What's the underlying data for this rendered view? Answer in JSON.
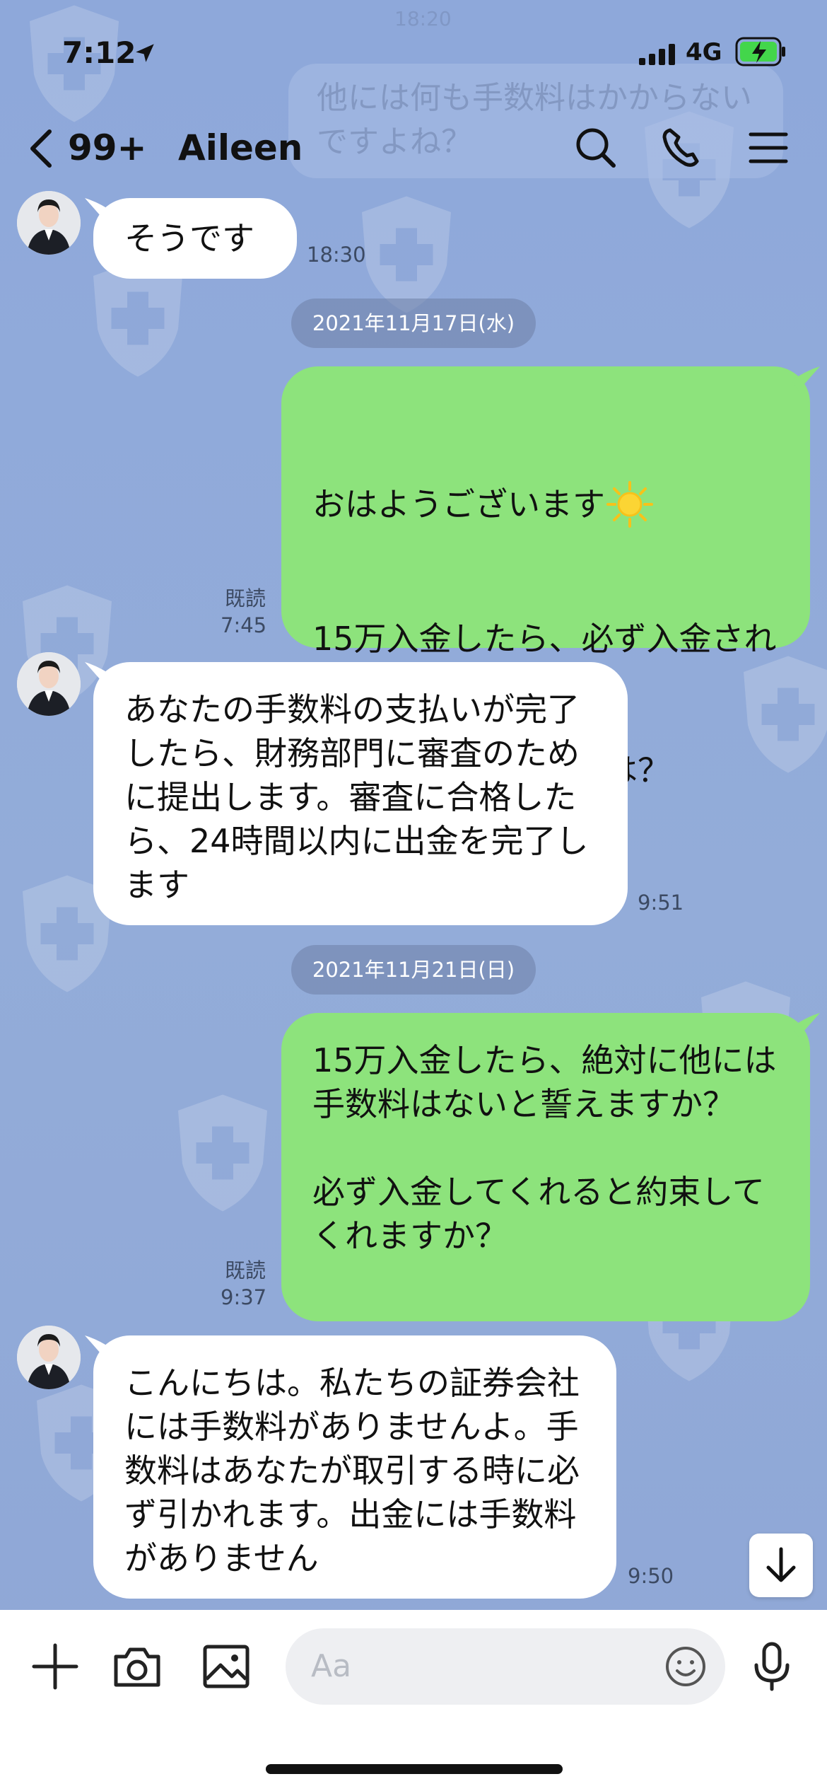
{
  "status": {
    "time": "7:12",
    "network": "4G"
  },
  "header": {
    "back_count": "99+",
    "title": "Aileen"
  },
  "ghost": {
    "time": "18:20",
    "text": "他には何も手数料はかからないですよね？"
  },
  "messages": {
    "m1": {
      "text": "そうです",
      "time": "18:30"
    },
    "date1": "2021年11月17日(水)",
    "m2": {
      "greeting": "おはようございます",
      "text": "15万入金したら、必ず入金されますか？\n\n入金までの所用時間は？",
      "read": "既読",
      "time": "7:45"
    },
    "m3": {
      "text": "あなたの手数料の支払いが完了したら、財務部門に審査のために提出します。審査に合格したら、24時間以内に出金を完了します",
      "time": "9:51"
    },
    "date2": "2021年11月21日(日)",
    "m4": {
      "text": "15万入金したら、絶対に他には手数料はないと誓えますか？\n\n必ず入金してくれると約束してくれますか？",
      "read": "既読",
      "time": "9:37"
    },
    "m5": {
      "text": "こんにちは。私たちの証券会社には手数料がありませんよ。手数料はあなたが取引する時に必ず引かれます。出金には手数料がありません",
      "time": "9:50"
    }
  },
  "input": {
    "placeholder": "Aa"
  },
  "colors": {
    "background": "#8fa8d8",
    "outgoing": "#8de37c",
    "incoming": "#ffffff"
  },
  "icons": [
    "location-arrow-icon",
    "signal-icon",
    "battery-charging-icon",
    "back-chevron-icon",
    "search-icon",
    "phone-icon",
    "menu-icon",
    "plus-icon",
    "camera-icon",
    "image-icon",
    "emoji-icon",
    "microphone-icon",
    "arrow-down-icon"
  ]
}
